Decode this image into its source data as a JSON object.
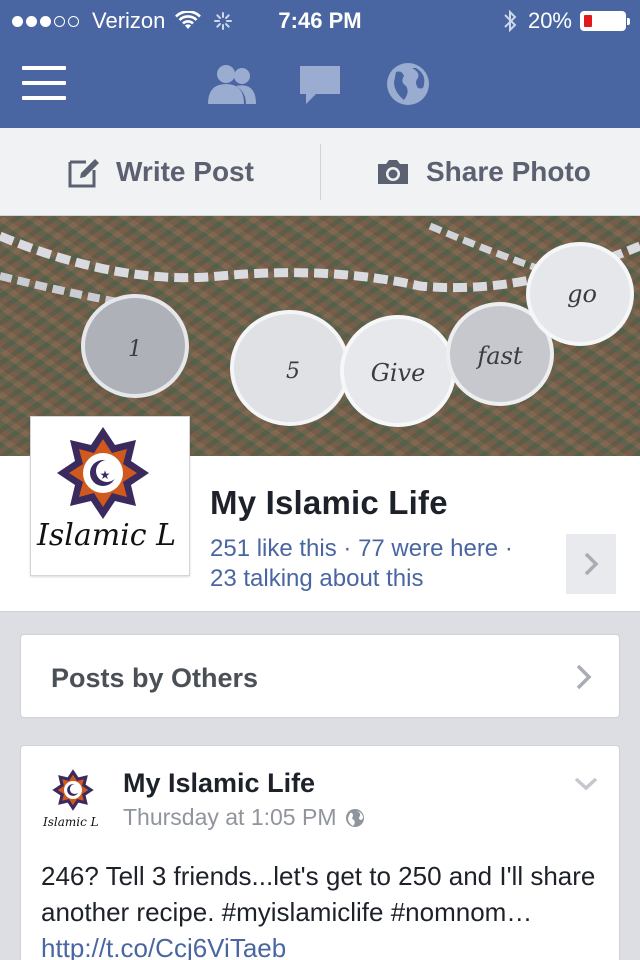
{
  "status_bar": {
    "carrier": "Verizon",
    "time": "7:46 PM",
    "battery_text": "20%",
    "battery_level": 0.2,
    "signal_bars_filled": 3,
    "signal_bars_total": 5
  },
  "nav": {
    "icons": [
      "menu-icon",
      "friend-requests-icon",
      "messages-icon",
      "notifications-globe-icon"
    ]
  },
  "actions": {
    "write_post": "Write Post",
    "share_photo": "Share Photo"
  },
  "page": {
    "name": "My Islamic Life",
    "profile_text": "Islamic L",
    "stats_line1": "251 like this · 77 were here ·",
    "stats_line2": "23 talking about this"
  },
  "cover": {
    "charms": [
      "1",
      "5",
      "Give",
      "fast",
      "go"
    ]
  },
  "posts_by_others": {
    "label": "Posts by Others"
  },
  "post": {
    "author": "My Islamic Life",
    "avatar_text": "Islamic L",
    "time": "Thursday at 1:05 PM",
    "text": "246? Tell 3 friends...let's get to 250 and I'll share another recipe. #myislamiclife #nomnom… ",
    "link": "http://t.co/Ccj6ViTaeb"
  },
  "colors": {
    "brand": "#4a66a2",
    "link": "#4a66a2",
    "battery_low": "#e0191c"
  }
}
